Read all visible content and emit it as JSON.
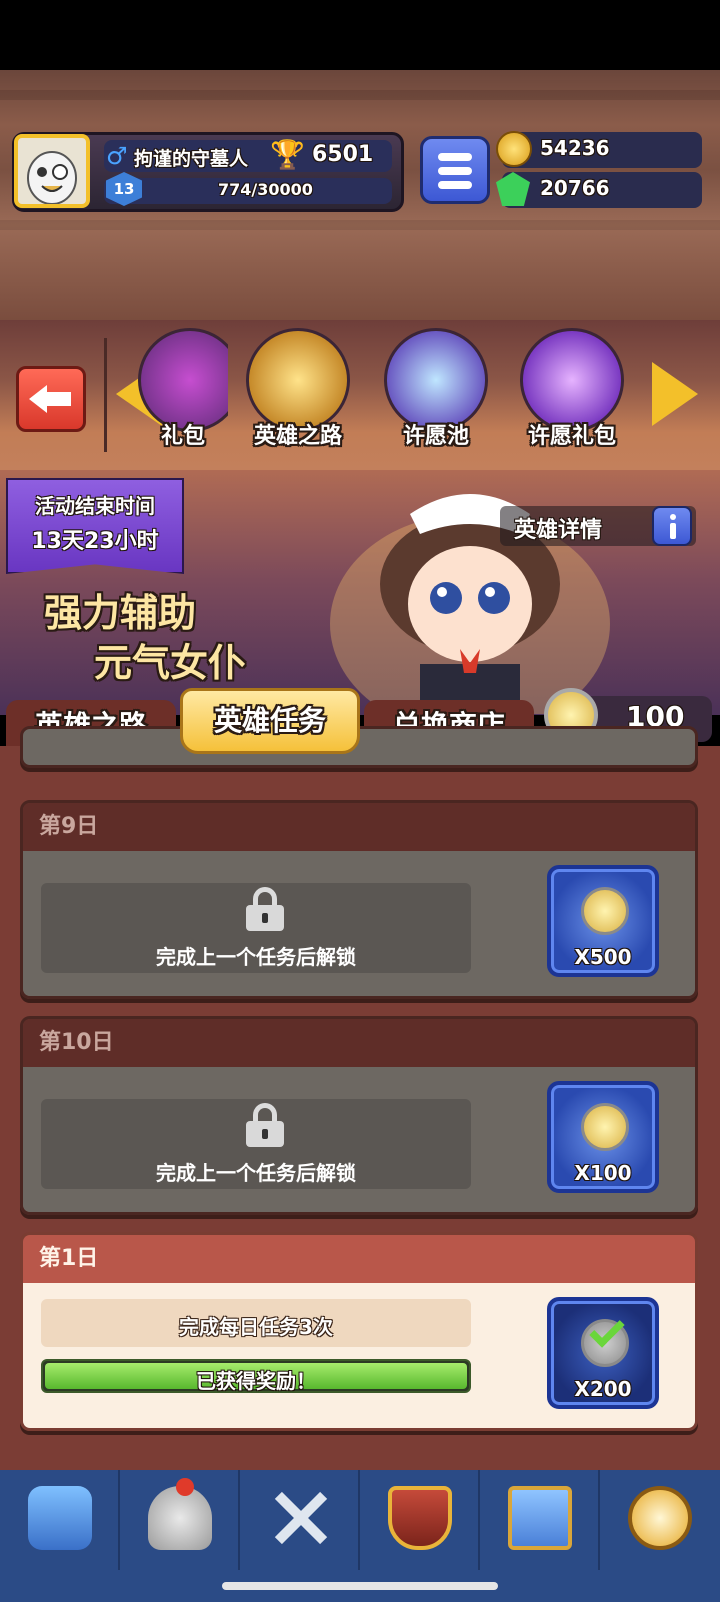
{
  "player": {
    "name": "拘谨的守墓人",
    "trophies": "6501",
    "level": "13",
    "xp": "774/30000"
  },
  "currency": {
    "gold": "54236",
    "gems": "20766"
  },
  "carousel": {
    "items": [
      "礼包",
      "英雄之路",
      "许愿池",
      "许愿礼包"
    ]
  },
  "event": {
    "timer_title": "活动结束时间",
    "timer_value": "13天23小时",
    "promo_line1": "强力辅助",
    "promo_line2": "元气女仆",
    "hero_details": "英雄详情",
    "token_count": "100"
  },
  "tabs": [
    "英雄之路",
    "英雄任务",
    "兑换商店"
  ],
  "missions": [
    {
      "day": "第9日",
      "task": "完成上一个任务后解锁",
      "reward": "X500",
      "locked": true
    },
    {
      "day": "第10日",
      "task": "完成上一个任务后解锁",
      "reward": "X100",
      "locked": true
    },
    {
      "day": "第1日",
      "task": "完成每日任务3次",
      "status": "已获得奖励！",
      "reward": "X200",
      "claimed": true,
      "progress": 1.0
    }
  ],
  "nav": [
    "treasure-chest-icon",
    "knight-helmet-icon",
    "crossed-swords-icon",
    "crown-shield-icon",
    "guild-banner-icon",
    "compass-icon"
  ],
  "colors": {
    "accent_gold": "#f3c02a",
    "button_blue": "#3d58d4",
    "progress_green": "#7fd14a"
  }
}
